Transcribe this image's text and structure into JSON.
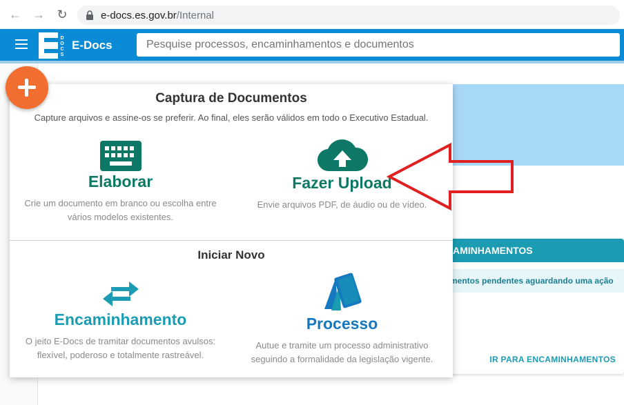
{
  "browser": {
    "url_domain": "e-docs.es.gov.br",
    "url_path": "/Internal"
  },
  "header": {
    "logo_letter": "E",
    "logo_small_text": "DOCS",
    "brand": "E-Docs",
    "search_placeholder": "Pesquise processos, encaminhamentos e documentos",
    "color": "#0b8ad6"
  },
  "popup": {
    "capture_title": "Captura de Documentos",
    "capture_subtitle": "Capture arquivos e assine-os se preferir. Ao final, eles serão válidos em todo o Executivo Estadual.",
    "options_capture": [
      {
        "title": "Elaborar",
        "desc1": "Crie um documento em branco ou escolha entre",
        "desc2": "vários modelos existentes.",
        "icon": "keyboard-icon"
      },
      {
        "title": "Fazer Upload",
        "desc1": "Envie arquivos PDF, de áudio ou de vídeo.",
        "desc2": "",
        "icon": "cloud-upload-icon"
      }
    ],
    "new_title": "Iniciar Novo",
    "options_new": [
      {
        "title": "Encaminhamento",
        "desc1": "O jeito E-Docs de tramitar documentos avulsos:",
        "desc2": "flexível, poderoso e totalmente rastreável.",
        "icon": "swap-arrows-icon"
      },
      {
        "title": "Processo",
        "desc1": "Autue e tramite um processo administrativo",
        "desc2": "seguindo a formalidade da legislação vigente.",
        "icon": "folder-stack-icon"
      }
    ],
    "green": "#0d7866",
    "blue": "#1679bf"
  },
  "background": {
    "enc_header": "AMINHAMENTOS",
    "enc_info": "mentos pendentes aguardando uma ação",
    "enc_link": "IR PARA ENCAMINHAMENTOS"
  },
  "fab": {
    "icon": "plus-icon",
    "color": "#f26d30"
  },
  "annotation": {
    "icon": "red-arrow-pointer",
    "color": "#e02020"
  }
}
